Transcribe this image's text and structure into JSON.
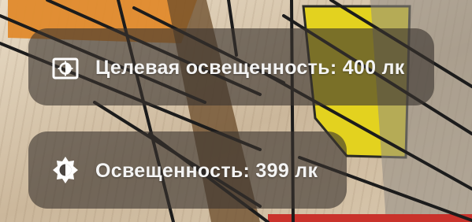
{
  "overlay": {
    "target_illuminance": {
      "icon": "brightness-target-icon",
      "label": "Целевая освещенность: 400 лк"
    },
    "current_illuminance": {
      "icon": "brightness-icon",
      "label": "Освещенность: 399 лк"
    }
  },
  "colors": {
    "panel_background": "#3a342f",
    "text": "#ffffff",
    "yellow_panel": "#e3d21f",
    "orange_panel": "#e08a2c",
    "red_strip": "#c9322b",
    "floor": "#d9cab4"
  }
}
